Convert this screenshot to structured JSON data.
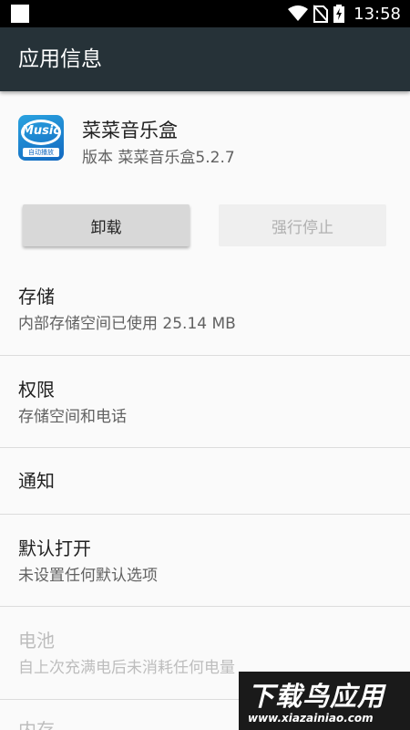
{
  "status_bar": {
    "time": "13:58",
    "icons": [
      "notification-square-icon",
      "wifi-icon",
      "no-sim-icon",
      "battery-charging-icon"
    ]
  },
  "toolbar": {
    "title": "应用信息"
  },
  "app": {
    "name": "菜菜音乐盒",
    "version": "版本 菜菜音乐盒5.2.7",
    "icon_text": "Music",
    "icon_subtext": "自动播放"
  },
  "buttons": {
    "uninstall": "卸载",
    "force_stop": "强行停止"
  },
  "settings": [
    {
      "title": "存储",
      "summary": "内部存储空间已使用 25.14 MB",
      "enabled": true
    },
    {
      "title": "权限",
      "summary": "存储空间和电话",
      "enabled": true
    },
    {
      "title": "通知",
      "summary": "",
      "enabled": true
    },
    {
      "title": "默认打开",
      "summary": "未设置任何默认选项",
      "enabled": true
    },
    {
      "title": "电池",
      "summary": "自上次充满电后未消耗任何电量",
      "enabled": false
    },
    {
      "title": "内存",
      "summary": "",
      "enabled": false
    }
  ],
  "watermark": {
    "title": "下载鸟应用",
    "url": "www.xiazainiao.com"
  },
  "colors": {
    "toolbar": "#263238",
    "status_bar": "#000000",
    "background": "#fafafa"
  }
}
